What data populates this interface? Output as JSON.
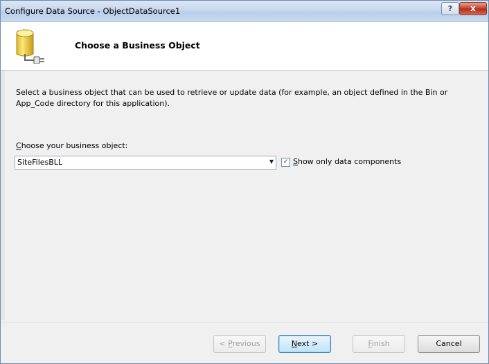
{
  "window": {
    "title": "Configure Data Source - ObjectDataSource1",
    "help_label": "?",
    "close_label": "x"
  },
  "header": {
    "title": "Choose a Business Object",
    "icon": "database-plug-icon"
  },
  "body": {
    "description": "Select a business object that can be used to retrieve or update data (for example, an object defined in the Bin or App_Code directory for this application).",
    "choose_label_accel": "C",
    "choose_label_rest": "hoose your business object:",
    "business_object_value": "SiteFilesBLL",
    "show_only_accel": "S",
    "show_only_rest": "how only data components",
    "show_only_checked": true
  },
  "footer": {
    "previous_prefix": "< ",
    "previous_accel": "P",
    "previous_rest": "revious",
    "next_accel": "N",
    "next_rest": "ext >",
    "finish_accel": "F",
    "finish_rest": "inish",
    "cancel_label": "Cancel"
  }
}
